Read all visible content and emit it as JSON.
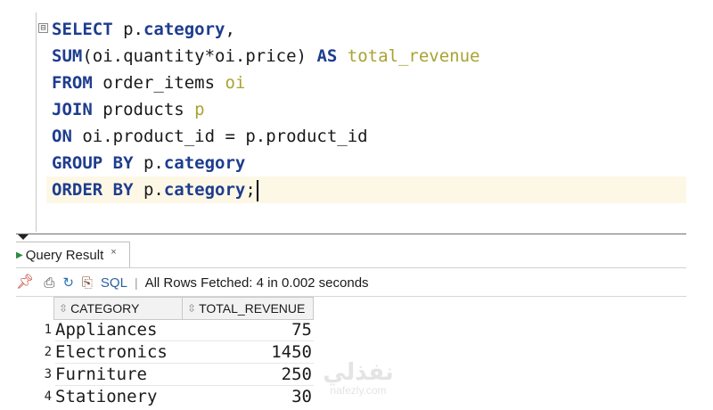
{
  "editor": {
    "fold_marker": "⊟",
    "lines": [
      [
        {
          "t": "SELECT",
          "c": "kw"
        },
        {
          "t": " p."
        },
        {
          "t": "category",
          "c": "kw"
        },
        {
          "t": ","
        }
      ],
      [
        {
          "t": "SUM",
          "c": "kw"
        },
        {
          "t": "(oi.quantity*oi.price) "
        },
        {
          "t": "AS",
          "c": "kw"
        },
        {
          "t": " "
        },
        {
          "t": "total_revenue",
          "c": "alias"
        }
      ],
      [
        {
          "t": "FROM",
          "c": "kw"
        },
        {
          "t": " order_items "
        },
        {
          "t": "oi",
          "c": "alias"
        }
      ],
      [
        {
          "t": "JOIN",
          "c": "kw"
        },
        {
          "t": " products "
        },
        {
          "t": "p",
          "c": "alias"
        }
      ],
      [
        {
          "t": "ON",
          "c": "kw"
        },
        {
          "t": " oi.product_id = p.product_id"
        }
      ],
      [
        {
          "t": "GROUP BY",
          "c": "kw"
        },
        {
          "t": " p."
        },
        {
          "t": "category",
          "c": "kw"
        }
      ],
      [
        {
          "t": "ORDER BY",
          "c": "kw"
        },
        {
          "t": " p."
        },
        {
          "t": "category",
          "c": "kw"
        },
        {
          "t": ";"
        }
      ]
    ],
    "current_line": 6
  },
  "result_tab": {
    "label": "Query Result",
    "close": "×"
  },
  "toolbar": {
    "icons": [
      "pin-icon",
      "print-icon",
      "refresh-icon",
      "export-icon"
    ],
    "sql_label": "SQL",
    "separator": "|",
    "status": "All Rows Fetched: 4 in 0.002 seconds"
  },
  "grid": {
    "columns": [
      "CATEGORY",
      "TOTAL_REVENUE"
    ],
    "rows": [
      {
        "num": "1",
        "category": "Appliances",
        "total": "75"
      },
      {
        "num": "2",
        "category": "Electronics",
        "total": "1450"
      },
      {
        "num": "3",
        "category": "Furniture",
        "total": "250"
      },
      {
        "num": "4",
        "category": "Stationery",
        "total": "30"
      }
    ]
  },
  "watermark": {
    "logo": "نفذلي",
    "domain": "nafezly.com"
  },
  "colors": {
    "keyword": "#1e3d8f",
    "alias": "#a8a332",
    "current_line_bg": "#fdf8e6"
  }
}
